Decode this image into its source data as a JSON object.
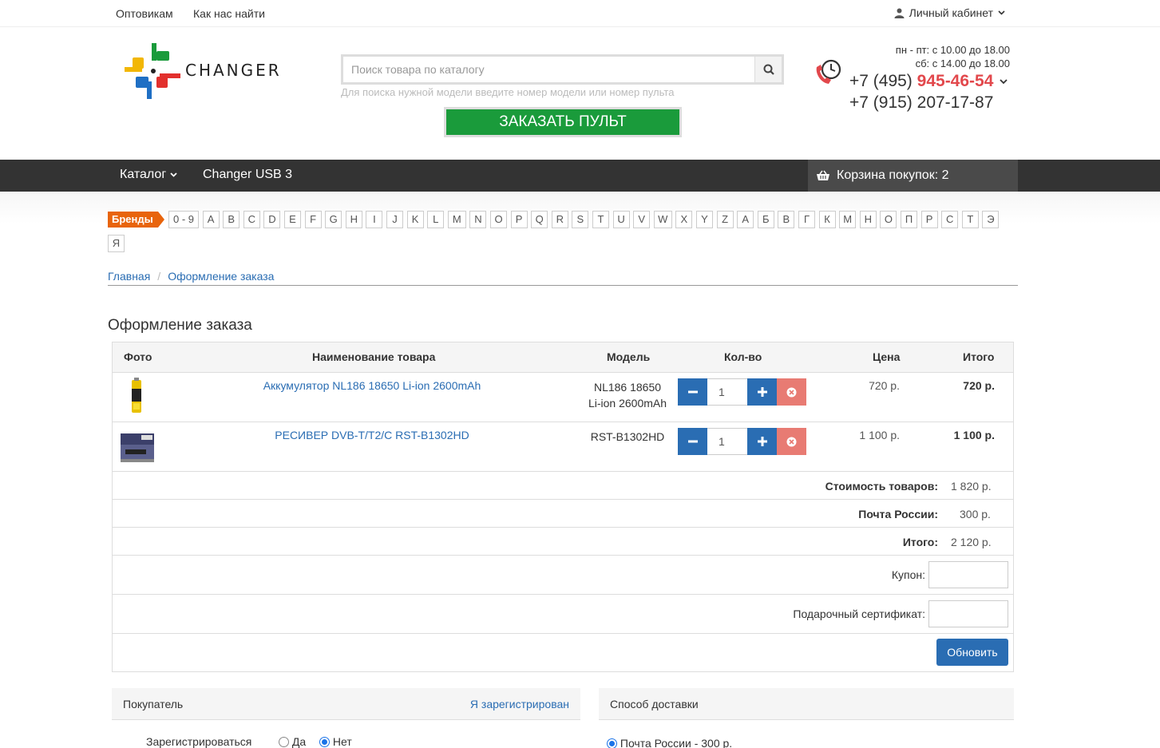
{
  "topbar": {
    "links": [
      "Оптовикам",
      "Как нас найти"
    ],
    "account": "Личный кабинет"
  },
  "header": {
    "logo_text": "CHANGER",
    "search_placeholder": "Поиск товара по каталогу",
    "search_hint": "Для поиска нужной модели введите номер модели или номер пульта",
    "order_button": "ЗАКАЗАТЬ ПУЛЬТ",
    "hours_weekdays": "пн - пт: с 10.00 до 18.00",
    "hours_saturday": "сб: с 14.00 до 18.00",
    "phone1_code": "+7 (495)",
    "phone1_number": "945-46-54",
    "phone2": "+7 (915) 207-17-87"
  },
  "nav": {
    "catalog": "Каталог",
    "item2": "Changer USB 3",
    "cart": "Корзина покупок: 2"
  },
  "brands": {
    "label": "Бренды",
    "letters": [
      "0 - 9",
      "A",
      "B",
      "C",
      "D",
      "E",
      "F",
      "G",
      "H",
      "I",
      "J",
      "K",
      "L",
      "M",
      "N",
      "O",
      "P",
      "Q",
      "R",
      "S",
      "T",
      "U",
      "V",
      "W",
      "X",
      "Y",
      "Z",
      "А",
      "Б",
      "В",
      "Г",
      "К",
      "М",
      "Н",
      "О",
      "П",
      "Р",
      "С",
      "Т",
      "Э",
      "Я"
    ]
  },
  "breadcrumb": [
    "Главная",
    "Оформление заказа"
  ],
  "page_title": "Оформление заказа",
  "table": {
    "headers": {
      "photo": "Фото",
      "name": "Наименование товара",
      "model": "Модель",
      "qty": "Кол-во",
      "price": "Цена",
      "total": "Итого"
    },
    "rows": [
      {
        "name": "Аккумулятор NL186 18650 Li-ion 2600mAh",
        "model_line1": "NL186 18650",
        "model_line2": "Li-ion 2600mAh",
        "qty": "1",
        "price": "720 р.",
        "total": "720 р."
      },
      {
        "name": "РЕСИВЕР DVB-T/T2/C RST-B1302HD",
        "model_line1": "RST-B1302HD",
        "model_line2": "",
        "qty": "1",
        "price": "1 100 р.",
        "total": "1 100 р."
      }
    ],
    "summary": [
      {
        "label": "Стоимость товаров:",
        "value": "1 820 р."
      },
      {
        "label": "Почта России:",
        "value": "300 р."
      },
      {
        "label": "Итого:",
        "value": "2 120 р."
      }
    ],
    "coupon_label": "Купон:",
    "gift_label": "Подарочный сертификат:",
    "update_button": "Обновить"
  },
  "buyer": {
    "title": "Покупатель",
    "registered_link": "Я зарегистрирован",
    "register_label": "Зарегистрироваться",
    "yes": "Да",
    "no": "Нет"
  },
  "delivery": {
    "title": "Способ доставки",
    "option": "Почта России - 300 р."
  }
}
